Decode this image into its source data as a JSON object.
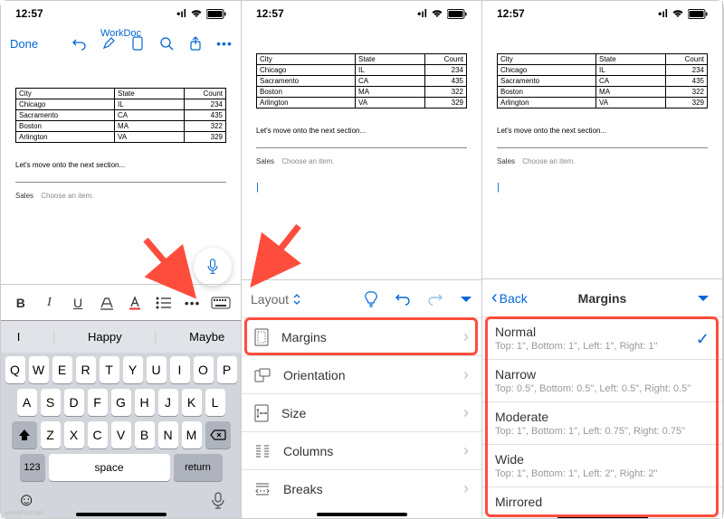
{
  "time": "12:57",
  "doc_title": "WorkDoc",
  "toolbar": {
    "done": "Done"
  },
  "table": {
    "headers": [
      "City",
      "State",
      "Count"
    ],
    "rows": [
      [
        "Chicago",
        "IL",
        "234"
      ],
      [
        "Sacramento",
        "CA",
        "435"
      ],
      [
        "Boston",
        "MA",
        "322"
      ],
      [
        "Arlington",
        "VA",
        "329"
      ]
    ]
  },
  "next_section": "Let's move onto the next section...",
  "sales": {
    "label": "Sales",
    "choose": "Choose an item."
  },
  "suggestions": [
    "I",
    "Happy",
    "Maybe"
  ],
  "keyboard": {
    "row1": [
      "Q",
      "W",
      "E",
      "R",
      "T",
      "Y",
      "U",
      "I",
      "O",
      "P"
    ],
    "row2": [
      "A",
      "S",
      "D",
      "F",
      "G",
      "H",
      "J",
      "K",
      "L"
    ],
    "row3": [
      "Z",
      "X",
      "C",
      "V",
      "B",
      "N",
      "M"
    ],
    "k123": "123",
    "space": "space",
    "ret": "return"
  },
  "layout_panel": {
    "title": "Layout",
    "items": [
      {
        "label": "Margins"
      },
      {
        "label": "Orientation"
      },
      {
        "label": "Size"
      },
      {
        "label": "Columns"
      },
      {
        "label": "Breaks"
      }
    ]
  },
  "margins_panel": {
    "back": "Back",
    "title": "Margins",
    "options": [
      {
        "name": "Normal",
        "desc": "Top: 1\", Bottom: 1\", Left: 1\", Right: 1\"",
        "selected": true
      },
      {
        "name": "Narrow",
        "desc": "Top: 0.5\", Bottom: 0.5\", Left: 0.5\", Right: 0.5\""
      },
      {
        "name": "Moderate",
        "desc": "Top: 1\", Bottom: 1\", Left: 0.75\", Right: 0.75\""
      },
      {
        "name": "Wide",
        "desc": "Top: 1\", Bottom: 1\", Left: 2\", Right: 2\""
      },
      {
        "name": "Mirrored",
        "desc": ""
      }
    ]
  }
}
